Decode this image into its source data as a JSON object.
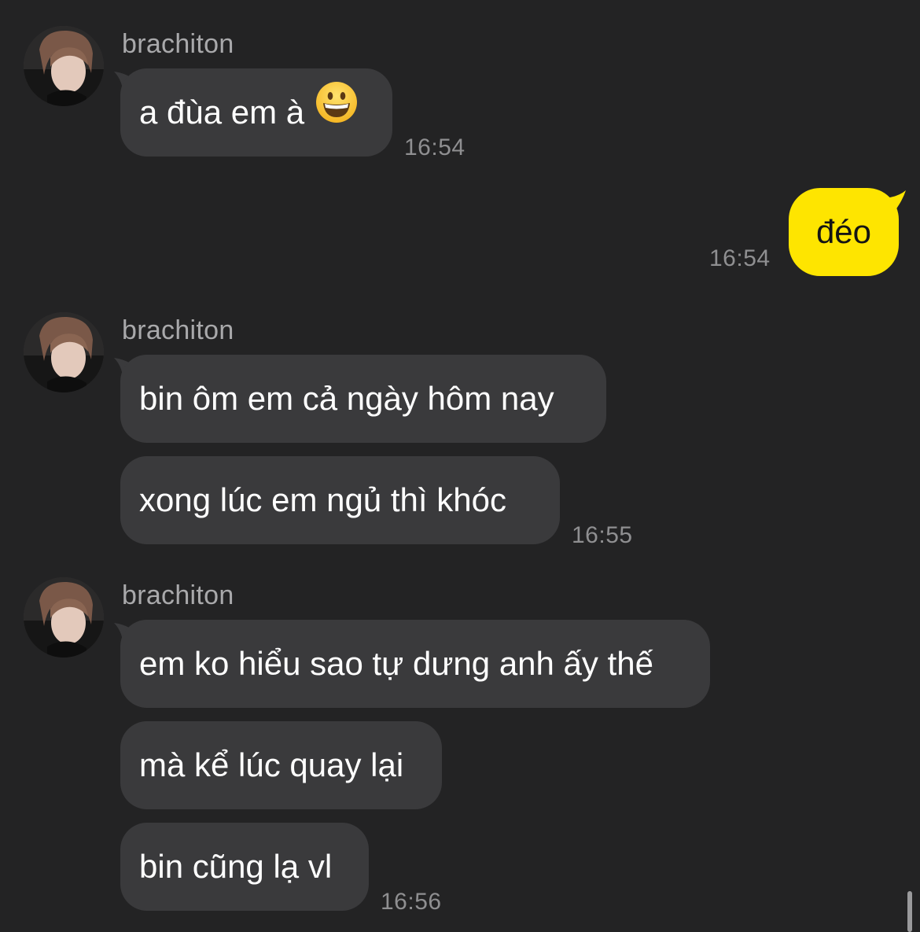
{
  "messages_group_1": {
    "sender": "brachiton",
    "bubble_1": "a đùa em à",
    "bubble_1_emoji": "grinning-face-emoji",
    "time": "16:54"
  },
  "my_message": {
    "text": "đéo",
    "time": "16:54"
  },
  "messages_group_2": {
    "sender": "brachiton",
    "bubble_1": "bin ôm em cả ngày hôm nay",
    "bubble_2": "xong lúc em ngủ thì khóc",
    "time": "16:55"
  },
  "messages_group_3": {
    "sender": "brachiton",
    "bubble_1": "em ko hiểu sao tự dưng anh ấy thế",
    "bubble_2": "mà kể lúc quay lại",
    "bubble_3": "bin cũng lạ vl",
    "time": "16:56"
  },
  "colors": {
    "background": "#232324",
    "incoming_bubble": "#3a3a3c",
    "outgoing_bubble": "#fee500",
    "meta_text": "#8f8f91"
  }
}
